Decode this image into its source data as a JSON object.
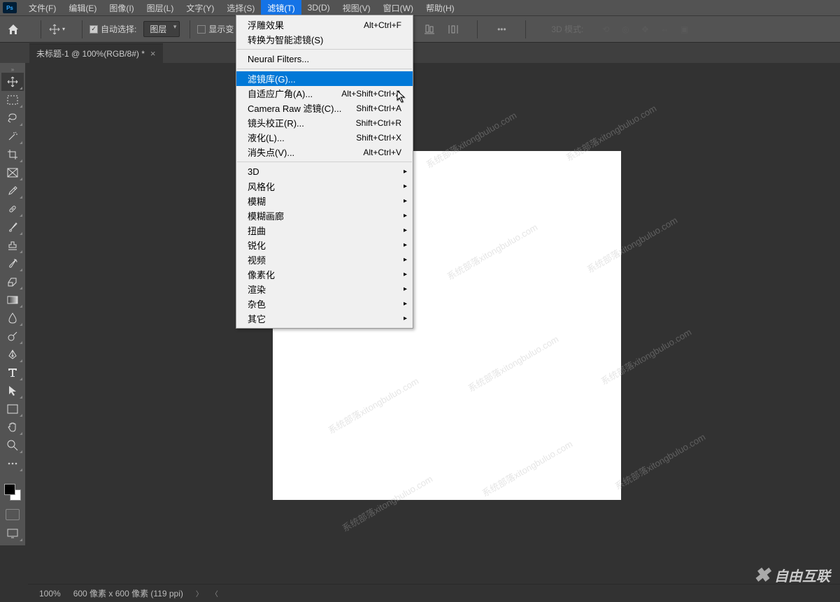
{
  "menubar": {
    "items": [
      "文件(F)",
      "编辑(E)",
      "图像(I)",
      "图层(L)",
      "文字(Y)",
      "选择(S)",
      "滤镜(T)",
      "3D(D)",
      "视图(V)",
      "窗口(W)",
      "帮助(H)"
    ],
    "active_index": 6
  },
  "optbar": {
    "auto_select_label": "自动选择:",
    "select_value": "图层",
    "show_transform_label": "显示变",
    "threed_mode_label": "3D 模式:"
  },
  "tab": {
    "title": "未标题-1 @ 100%(RGB/8#) *"
  },
  "dropdown": {
    "items": [
      {
        "label": "浮雕效果",
        "shortcut": "Alt+Ctrl+F"
      },
      {
        "label": "转换为智能滤镜(S)"
      },
      {
        "sep": true
      },
      {
        "label": "Neural Filters..."
      },
      {
        "sep": true
      },
      {
        "label": "滤镜库(G)...",
        "highlighted": true
      },
      {
        "label": "自适应广角(A)...",
        "shortcut": "Alt+Shift+Ctrl+A"
      },
      {
        "label": "Camera Raw 滤镜(C)...",
        "shortcut": "Shift+Ctrl+A"
      },
      {
        "label": "镜头校正(R)...",
        "shortcut": "Shift+Ctrl+R"
      },
      {
        "label": "液化(L)...",
        "shortcut": "Shift+Ctrl+X"
      },
      {
        "label": "消失点(V)...",
        "shortcut": "Alt+Ctrl+V"
      },
      {
        "sep": true
      },
      {
        "label": "3D",
        "sub": true
      },
      {
        "label": "风格化",
        "sub": true
      },
      {
        "label": "模糊",
        "sub": true
      },
      {
        "label": "模糊画廊",
        "sub": true
      },
      {
        "label": "扭曲",
        "sub": true
      },
      {
        "label": "锐化",
        "sub": true
      },
      {
        "label": "视频",
        "sub": true
      },
      {
        "label": "像素化",
        "sub": true
      },
      {
        "label": "渲染",
        "sub": true
      },
      {
        "label": "杂色",
        "sub": true
      },
      {
        "label": "其它",
        "sub": true
      }
    ]
  },
  "statusbar": {
    "zoom": "100%",
    "info": "600 像素 x 600 像素 (119 ppi)"
  },
  "watermark_text": "系统部落xitongbuluo.com",
  "brand_text": "自由互联",
  "tools": [
    "move",
    "marquee",
    "lasso",
    "magic-wand",
    "crop",
    "frame",
    "eyedropper",
    "healing",
    "brush",
    "stamp",
    "history-brush",
    "eraser",
    "gradient",
    "blur",
    "dodge",
    "pen",
    "type",
    "path-select",
    "rectangle",
    "hand",
    "zoom",
    "more"
  ]
}
